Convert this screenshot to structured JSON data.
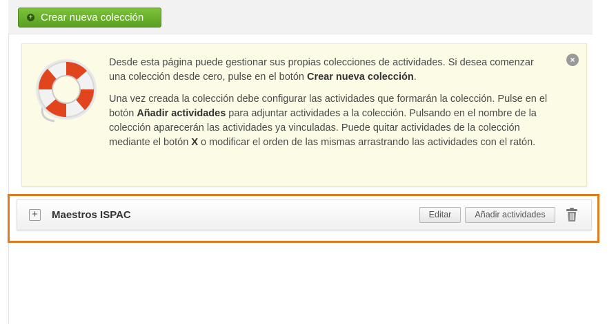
{
  "toolbar": {
    "create_collection_label": "Crear nueva colección"
  },
  "info": {
    "p1_before": "Desde esta página puede gestionar sus propias colecciones de actividades. Si desea comenzar una colección desde cero, pulse en el botón ",
    "p1_bold": "Crear nueva colección",
    "p1_after": ".",
    "p2_before": "Una vez creada la colección debe configurar las actividades que formarán la colección. Pulse en el botón ",
    "p2_bold1": "Añadir actividades",
    "p2_mid": " para adjuntar actividades a la colección. Pulsando en el nombre de la colección aparecerán las actividades ya vinculadas. Puede quitar actividades de la colección mediante el botón ",
    "p2_bold2": "X",
    "p2_after": " o modificar el orden de las mismas arrastrando las actividades con el ratón.",
    "close_glyph": "×"
  },
  "collection": {
    "expand_glyph": "+",
    "name": "Maestros ISPAC",
    "edit_label": "Editar",
    "add_activities_label": "Añadir actividades"
  },
  "colors": {
    "accent_green": "#58a020",
    "highlight_orange": "#e07a1f",
    "info_background": "#fbfbe6"
  }
}
